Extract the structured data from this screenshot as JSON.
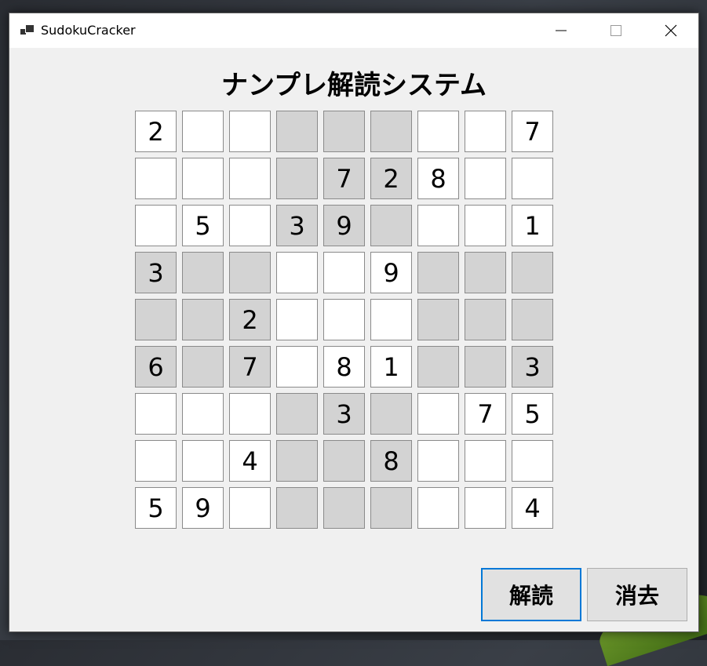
{
  "window": {
    "title": "SudokuCracker",
    "controls": {
      "minimize_icon": "minimize-icon",
      "maximize_icon": "maximize-icon",
      "close_icon": "close-icon"
    }
  },
  "main": {
    "heading": "ナンプレ解読システム",
    "grid": [
      [
        "2",
        "",
        "",
        "",
        "",
        "",
        "",
        "",
        "7"
      ],
      [
        "",
        "",
        "",
        "",
        "7",
        "2",
        "8",
        "",
        ""
      ],
      [
        "",
        "5",
        "",
        "3",
        "9",
        "",
        "",
        "",
        "1"
      ],
      [
        "3",
        "",
        "",
        "",
        "",
        "9",
        "",
        "",
        ""
      ],
      [
        "",
        "",
        "2",
        "",
        "",
        "",
        "",
        "",
        ""
      ],
      [
        "6",
        "",
        "7",
        "",
        "8",
        "1",
        "",
        "",
        "3"
      ],
      [
        "",
        "",
        "",
        "",
        "3",
        "",
        "",
        "7",
        "5"
      ],
      [
        "",
        "",
        "4",
        "",
        "",
        "8",
        "",
        "",
        ""
      ],
      [
        "5",
        "9",
        "",
        "",
        "",
        "",
        "",
        "",
        "4"
      ]
    ],
    "colors": {
      "shaded_cell": "#d3d3d3",
      "white_cell": "#ffffff",
      "focus_border": "#0078d7"
    }
  },
  "buttons": {
    "solve_label": "解読",
    "clear_label": "消去"
  }
}
